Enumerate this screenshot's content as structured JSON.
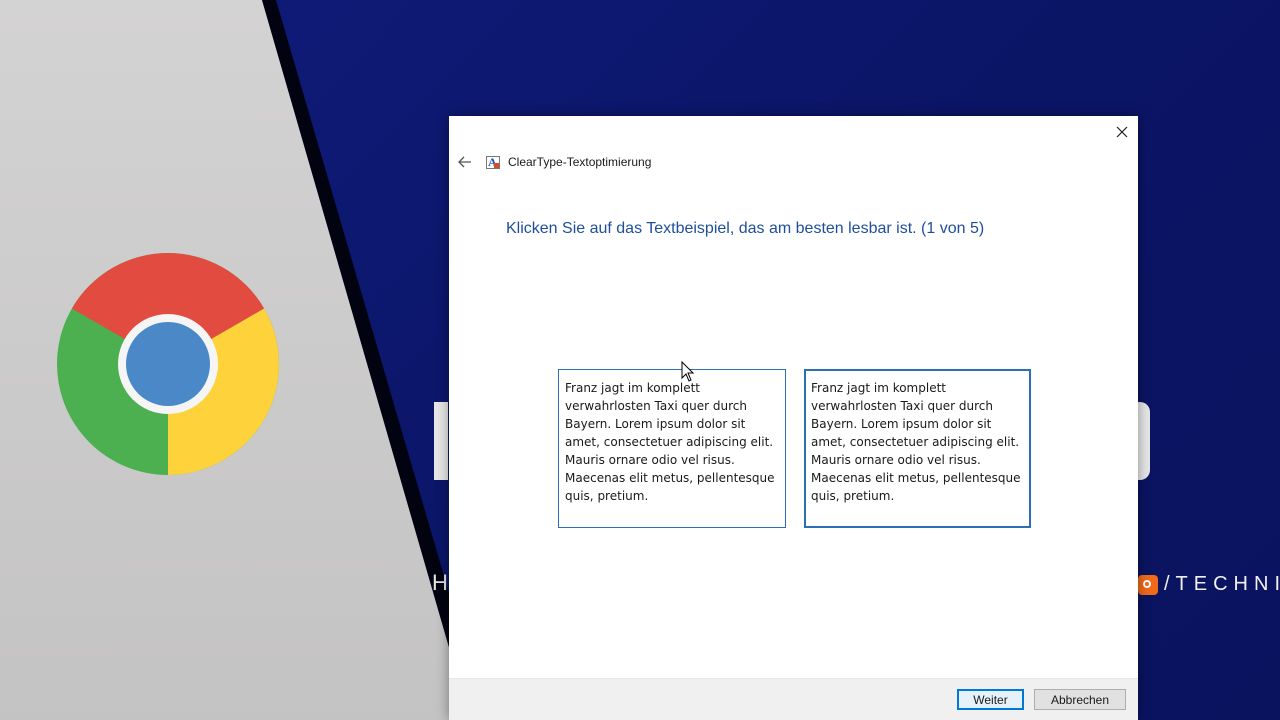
{
  "dialog": {
    "title": "ClearType-Textoptimierung",
    "instruction": "Klicken Sie auf das Textbeispiel, das am besten lesbar ist. (1 von 5)",
    "samples": [
      {
        "text": "Franz jagt im komplett verwahrlosten Taxi quer durch Bayern. Lorem ipsum dolor sit amet, consectetuer adipiscing elit. Mauris ornare odio vel risus. Maecenas elit metus, pellentesque quis, pretium."
      },
      {
        "text": "Franz jagt im komplett verwahrlosten Taxi quer durch Bayern. Lorem ipsum dolor sit amet, consectetuer adipiscing elit. Mauris ornare odio vel risus. Maecenas elit metus, pellentesque quis, pretium."
      }
    ],
    "buttons": {
      "next": "Weiter",
      "cancel": "Abbrechen"
    }
  },
  "background": {
    "letter": "H",
    "brand_text": "/TECHNIK"
  },
  "icons": [
    "close-icon",
    "back-arrow-icon",
    "cleartype-app-icon",
    "chrome-logo-icon",
    "mouse-cursor-icon"
  ],
  "colors": {
    "accent": "#0078d7",
    "instruction": "#1f4f9a",
    "background_blue": "#0e1a73"
  }
}
